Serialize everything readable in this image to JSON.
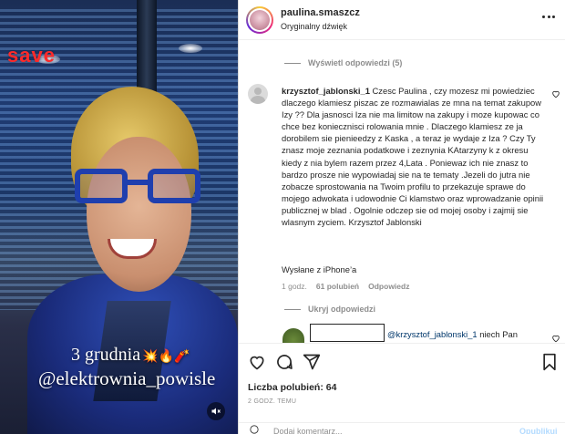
{
  "media": {
    "overlay_text": "save",
    "caption_date": "3 grudnia",
    "caption_emoji": "💥🔥🧨",
    "caption_tag": "@elektrownia_powisle",
    "mute_icon": "speaker-muted-icon"
  },
  "header": {
    "username": "paulina.smaszcz",
    "audio": "Oryginalny dźwięk",
    "more_icon": "more-horizontal-icon"
  },
  "thread": {
    "view_replies": "Wyświetl odpowiedzi (5)",
    "comment": {
      "author": "krzysztof_jablonski_1",
      "body": "Czesc Paulina , czy mozesz mi powiedziec dlaczego klamiesz piszac ze rozmawialas ze mna na temat zakupow Izy ?? Dla jasnosci Iza nie ma limitow na zakupy i moze kupowac co chce bez koniecznisci rolowania mnie . Dlaczego klamiesz ze ja dorobilem sie pienieedzy z Kaska , a teraz je wydaje z Iza ? Czy Ty znasz moje zeznania podatkowe i zeznynia KAtarzyny k z okresu kiedy z nia bylem razem przez 4,Lata . Poniewaz ich nie znasz to bardzo prosze nie wypowiadaj sie na te tematy .Jezeli do jutra nie zobacze sprostowania na Twoim profilu to przekazuje sprawe do mojego adwokata i udowodnie Ci klamstwo oraz wprowadzanie opinii publicznej w blad . Ogolnie odczep sie od mojej osoby i zajmij sie wlasnym zyciem. Krzysztof Jablonski",
      "signature": "Wysłane z iPhone’a",
      "time": "1 godz.",
      "likes": "61 polubień",
      "reply": "Odpowiedz"
    },
    "hide_replies": "Ukryj odpowiedzi",
    "reply": {
      "mention": "@krzysztof_jablonski_1",
      "text": "niech Pan"
    }
  },
  "actions": {
    "likes": "Liczba polubień: 64",
    "date": "2 GODZ. TEMU",
    "add_comment": "Dodaj komentarz...",
    "publish": "Opublikuj"
  }
}
